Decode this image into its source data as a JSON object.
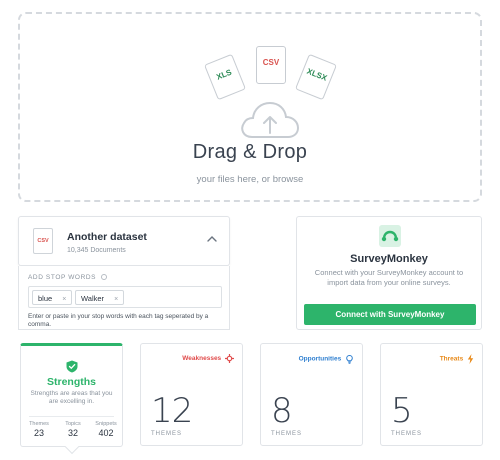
{
  "dropzone": {
    "file_types": [
      "XLS",
      "CSV",
      "XLSX"
    ],
    "title": "Drag & Drop",
    "subtitle": "your files here, or browse"
  },
  "dataset": {
    "icon_label": "CSV",
    "title": "Another dataset",
    "count": "10,345 Documents"
  },
  "stop_words": {
    "label": "ADD STOP WORDS",
    "tags": [
      {
        "text": "blue",
        "remove": "×"
      },
      {
        "text": "Walker",
        "remove": "×"
      }
    ],
    "help": "Enter or paste in your stop words with each tag seperated by a comma."
  },
  "surveymonkey": {
    "title": "SurveyMonkey",
    "description": "Connect with your SurveyMonkey account to import data from your online surveys.",
    "button": "Connect with SurveyMonkey",
    "brand_color": "#2db46b"
  },
  "strengths": {
    "title": "Strengths",
    "description": "Strengths are areas that you are excelling in.",
    "stats": [
      {
        "label": "Themes",
        "value": "23"
      },
      {
        "label": "Topics",
        "value": "32"
      },
      {
        "label": "Snippets",
        "value": "402"
      }
    ],
    "color": "#2db46b"
  },
  "themes": {
    "weaknesses": {
      "label": "Weaknesses",
      "count": "12",
      "sub": "THEMES",
      "icon": "weakness-icon",
      "color": "#e04b4b"
    },
    "opportunities": {
      "label": "Opportunities",
      "count": "8",
      "sub": "THEMES",
      "icon": "lightbulb-icon",
      "color": "#2f7fd0"
    },
    "threats": {
      "label": "Threats",
      "count": "5",
      "sub": "THEMES",
      "icon": "lightning-icon",
      "color": "#e88a1a"
    }
  }
}
